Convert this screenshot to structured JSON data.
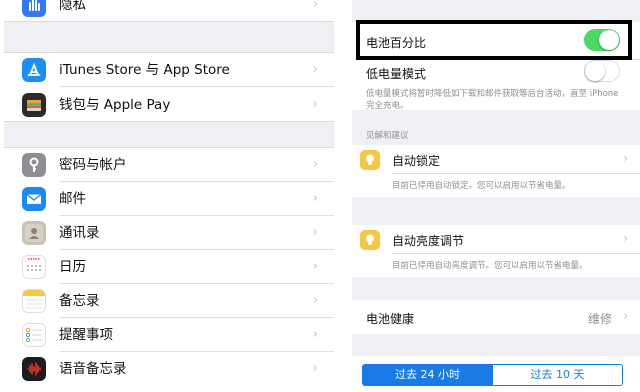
{
  "left": {
    "top_item": {
      "label": "隐私",
      "icon": "hand-icon"
    },
    "group1": [
      {
        "label": "iTunes Store 与 App Store",
        "icon": "app-store-icon"
      },
      {
        "label": "钱包与 Apple Pay",
        "icon": "wallet-icon"
      }
    ],
    "group2": [
      {
        "label": "密码与帐户",
        "icon": "key-icon"
      },
      {
        "label": "邮件",
        "icon": "mail-icon"
      },
      {
        "label": "通讯录",
        "icon": "contacts-icon"
      },
      {
        "label": "日历",
        "icon": "calendar-icon"
      },
      {
        "label": "备忘录",
        "icon": "notes-icon"
      },
      {
        "label": "提醒事项",
        "icon": "reminders-icon"
      },
      {
        "label": "语音备忘录",
        "icon": "voice-memos-icon"
      }
    ],
    "chevron": "›"
  },
  "right": {
    "battery_percentage": {
      "label": "电池百分比",
      "on": true
    },
    "low_power": {
      "label": "低电量模式",
      "on": false
    },
    "low_power_note": "低电量模式将暂时降低如下载和邮件获取等后台活动，直至 iPhone 完全充电。",
    "insights_header": "见解和建议",
    "auto_lock": {
      "label": "自动锁定",
      "note": "目前已停用自动锁定。您可以启用以节省电量。"
    },
    "auto_brightness": {
      "label": "自动亮度调节",
      "note": "目前已停用自动亮度调节。您可以启用以节省电量。"
    },
    "battery_health": {
      "label": "电池健康",
      "value": "维修"
    },
    "segments": [
      "过去 24 小时",
      "过去 10 天"
    ],
    "chevron": "›",
    "colors": {
      "toggle_on": "#4cd964",
      "bulb": "#f6c644",
      "accent": "#1a7be6"
    }
  }
}
